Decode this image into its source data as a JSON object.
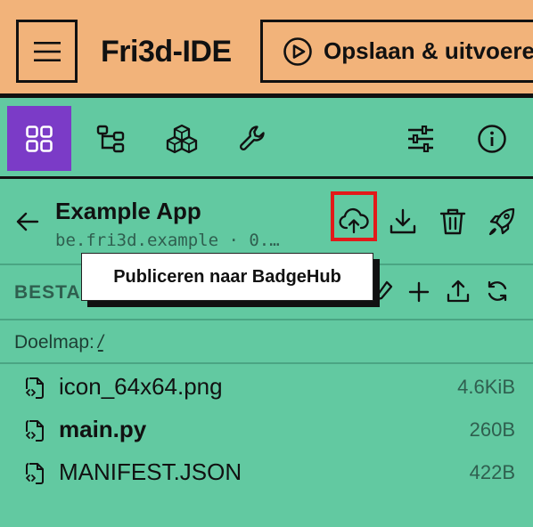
{
  "header": {
    "brand": "Fri3d-IDE",
    "run_label": "Opslaan & uitvoeren"
  },
  "toolbar": {
    "icons": [
      "apps-grid-icon",
      "tree-structure-icon",
      "packages-icon",
      "wrench-icon",
      "sliders-icon",
      "info-icon"
    ]
  },
  "project": {
    "title": "Example App",
    "id": "be.fri3d.example · 0.…",
    "tooltip": "Publiceren naar BadgeHub"
  },
  "files_section": {
    "label": "BESTA",
    "target_label": "Doelmap:",
    "target_path": "/"
  },
  "files": [
    {
      "name": "icon_64x64.png",
      "size": "4.6KiB",
      "bold": false
    },
    {
      "name": "main.py",
      "size": "260B",
      "bold": true
    },
    {
      "name": "MANIFEST.JSON",
      "size": "422B",
      "bold": false
    }
  ],
  "colors": {
    "header_bg": "#f2b37a",
    "panel_bg": "#62c9a1",
    "active_tab": "#7b3bc7",
    "highlight": "#e21a1a"
  }
}
